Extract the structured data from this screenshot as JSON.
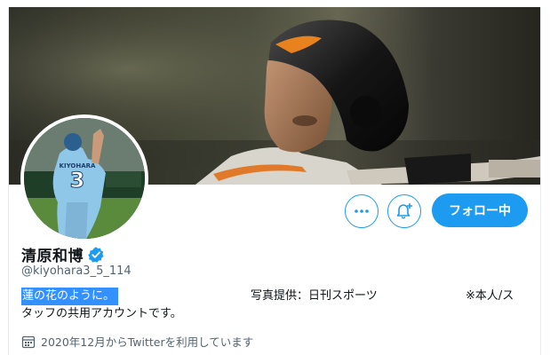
{
  "profile": {
    "display_name": "清原和博",
    "handle": "@kiyohara3_5_114",
    "bio_selected": "蓮の花のように。",
    "bio_photo_credit": "写真提供：日刊スポーツ",
    "bio_note": "※本人/ス",
    "bio_line2": "タッフの共用アカウントです。",
    "joined": "2020年12月からTwitterを利用しています"
  },
  "buttons": {
    "follow_label": "フォロー中"
  },
  "avatar": {
    "jersey_number": "3",
    "jersey_name": "KIYOHARA"
  },
  "colors": {
    "accent": "#1d9bf0",
    "selection": "#3390ff",
    "secondary_text": "#536471"
  },
  "icons": [
    "more-icon",
    "notification-bell-icon",
    "verified-badge-icon",
    "calendar-icon"
  ]
}
